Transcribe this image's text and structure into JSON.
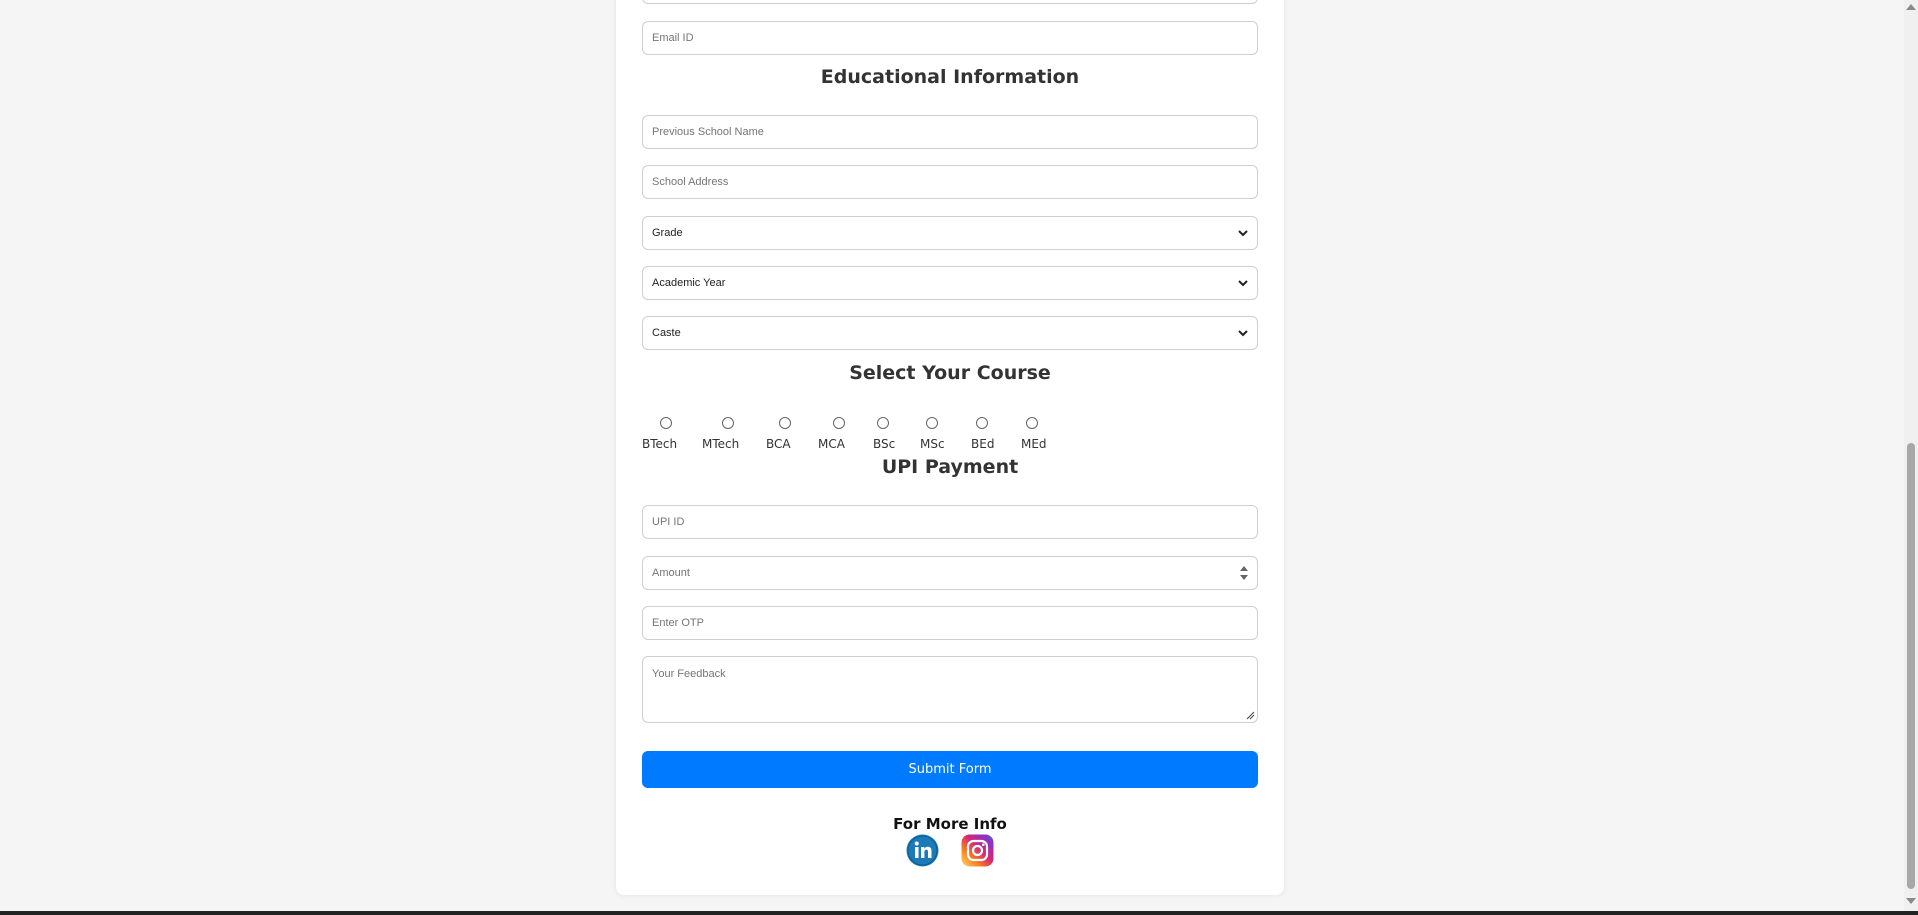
{
  "form": {
    "email_placeholder": "Email ID",
    "education_heading": "Educational Information",
    "school_name_placeholder": "Previous School Name",
    "school_address_placeholder": "School Address",
    "grade_select": "Grade",
    "academic_year_select": "Academic Year",
    "caste_select": "Caste",
    "course_heading": "Select Your Course",
    "courses": [
      "BTech",
      "MTech",
      "BCA",
      "MCA",
      "BSc",
      "MSc",
      "BEd",
      "MEd"
    ],
    "upi_heading": "UPI Payment",
    "upi_placeholder": "UPI ID",
    "amount_placeholder": "Amount",
    "otp_placeholder": "Enter OTP",
    "feedback_placeholder": "Your Feedback",
    "submit_label": "Submit Form",
    "more_info_label": "For More Info"
  },
  "social": {
    "linkedin_icon": "linkedin-icon",
    "instagram_icon": "instagram-icon",
    "linkedin_color": "#0a66c2",
    "instagram_colors": [
      "#feda75",
      "#fa7e1e",
      "#d62976",
      "#962fbf",
      "#4f5bd5"
    ]
  },
  "colors": {
    "accent": "#007bff",
    "background": "#f5f5f5",
    "card": "#ffffff"
  }
}
